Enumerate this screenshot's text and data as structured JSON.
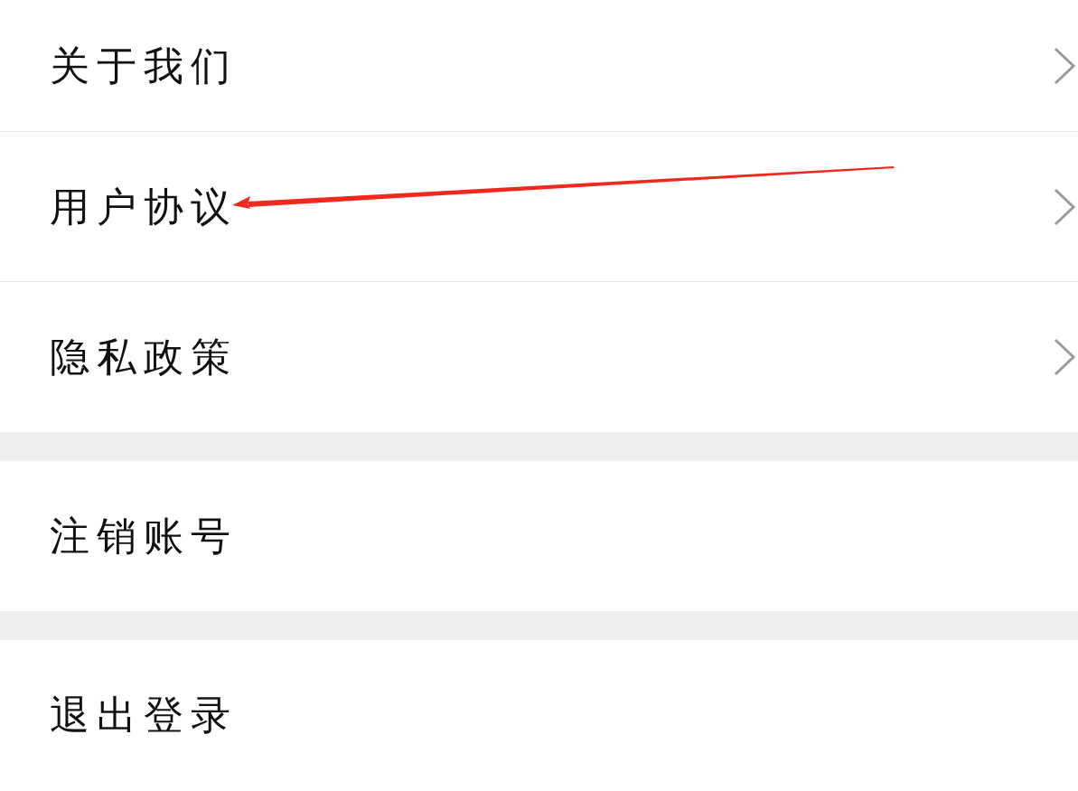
{
  "groups": [
    {
      "items": [
        {
          "label": "关于我们",
          "chevron": true,
          "annotated": false
        },
        {
          "label": "用户协议",
          "chevron": true,
          "annotated": true
        },
        {
          "label": "隐私政策",
          "chevron": true,
          "annotated": false
        }
      ]
    },
    {
      "items": [
        {
          "label": "注销账号",
          "chevron": false,
          "annotated": false
        }
      ]
    },
    {
      "items": [
        {
          "label": "退出登录",
          "chevron": false,
          "annotated": false
        }
      ]
    }
  ]
}
